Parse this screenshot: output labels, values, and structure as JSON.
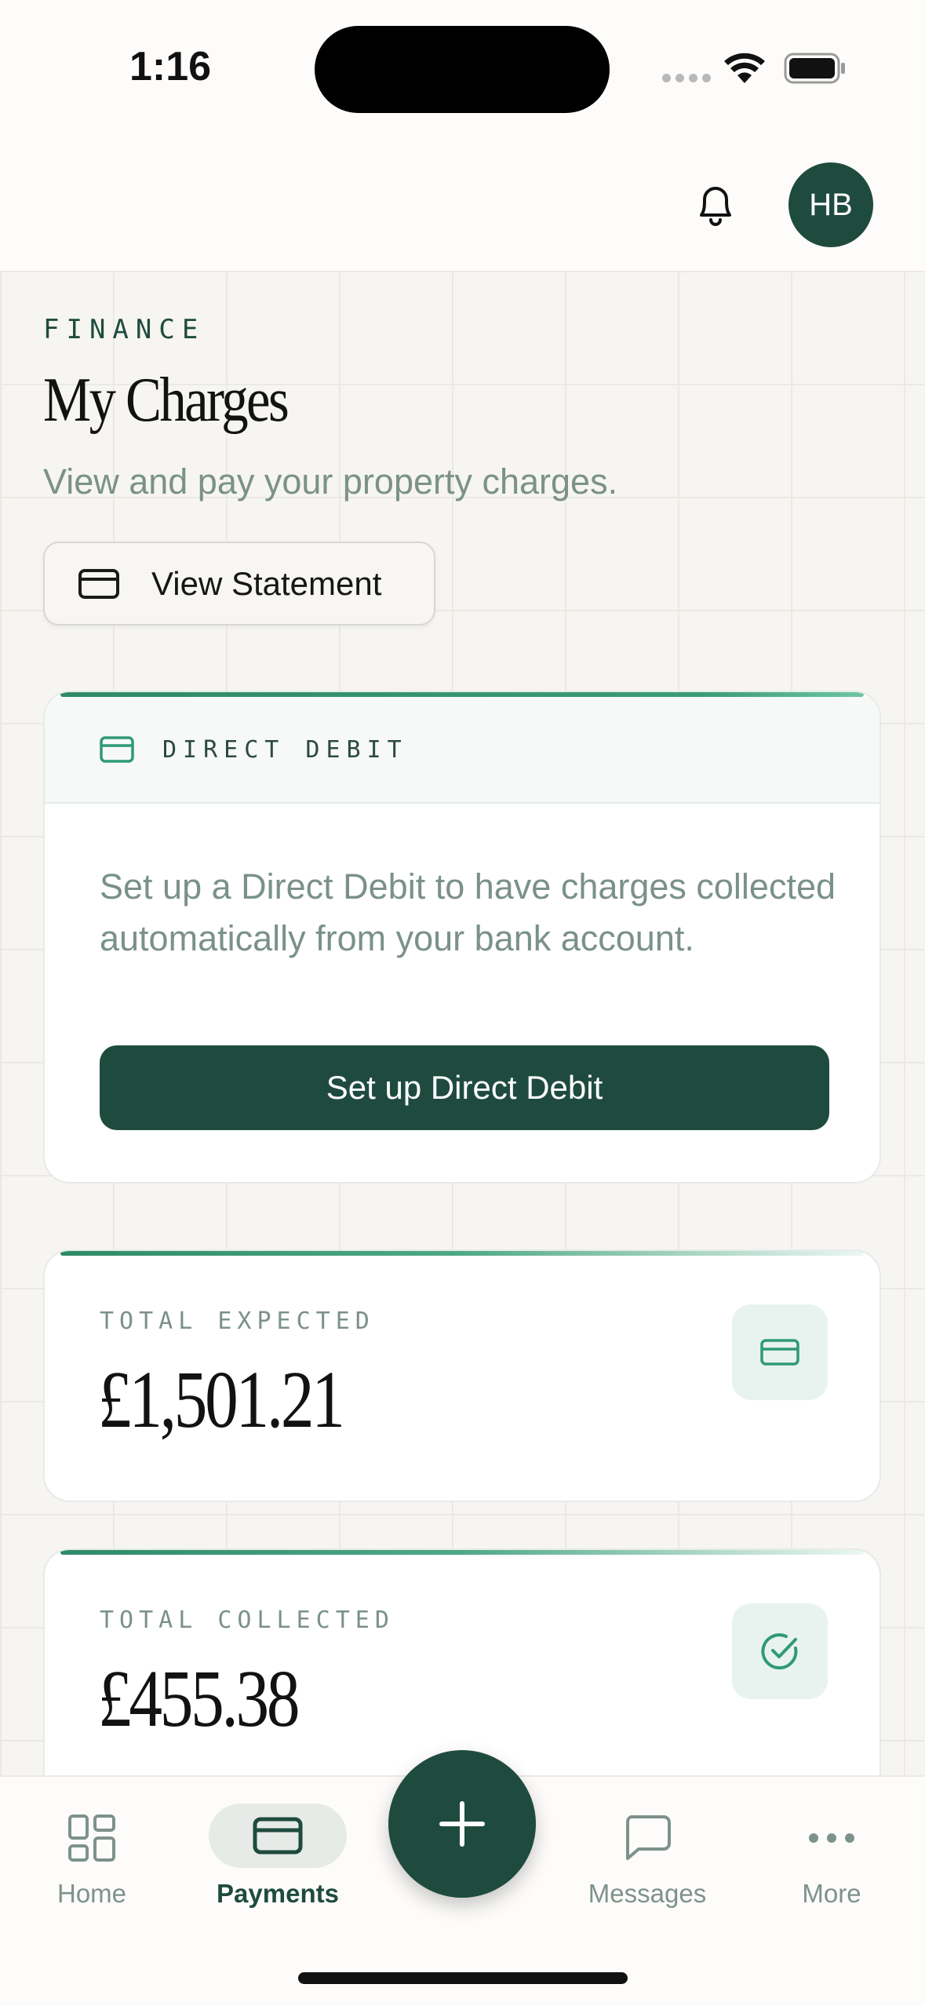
{
  "status_bar": {
    "time": "1:16"
  },
  "header": {
    "avatar_initials": "HB"
  },
  "page": {
    "eyebrow": "FINANCE",
    "title": "My Charges",
    "subtitle": "View and pay your property charges.",
    "statement_button": "View Statement"
  },
  "direct_debit": {
    "heading": "DIRECT DEBIT",
    "description": "Set up a Direct Debit to have charges collected automatically from your bank account.",
    "button": "Set up Direct Debit"
  },
  "stats": {
    "expected": {
      "label": "TOTAL EXPECTED",
      "value": "£1,501.21",
      "icon": "card-icon"
    },
    "collected": {
      "label": "TOTAL COLLECTED",
      "value": "£455.38",
      "icon": "check-circle-icon"
    }
  },
  "tabs": [
    {
      "label": "Home",
      "icon": "grid-icon"
    },
    {
      "label": "Payments",
      "icon": "card-icon"
    },
    {
      "label": "Messages",
      "icon": "chat-icon"
    },
    {
      "label": "More",
      "icon": "more-icon"
    }
  ],
  "colors": {
    "brand": "#1f4b3f",
    "accent": "#2f8a6a",
    "muted_text": "#7a918a",
    "background": "#f6f5f1"
  }
}
